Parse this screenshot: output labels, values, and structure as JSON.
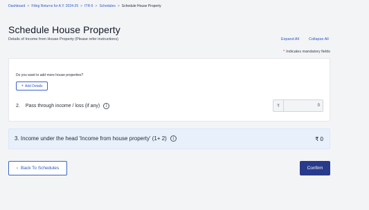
{
  "breadcrumb": {
    "items": [
      "Dashboard",
      "Filing Returns for A.Y. 2024-25",
      "ITR-5",
      "Schedules"
    ],
    "current": "Schedule House Property",
    "separator": ">"
  },
  "page": {
    "title": "Schedule House Property",
    "subtitle": "Details of Income from House Property (Please refer instructions)"
  },
  "controls": {
    "expand_all": "Expand All",
    "collapse_all": "Collapse All",
    "mandatory_star": "*",
    "mandatory_note": "Indicates mandatory fields"
  },
  "card": {
    "question": "Do you want to add more house properties?",
    "add_details_label": "Add Details",
    "pass_through_number": "2.",
    "pass_through_label": "Pass through income / loss (if any)",
    "currency_symbol": "₹",
    "pass_through_value": "0"
  },
  "income": {
    "label": "3. Income under the head 'Income from house property' (1+ 2)",
    "total": "₹ 0"
  },
  "footer": {
    "back_label": "Back To Schedules",
    "confirm_label": "Confirm"
  },
  "colors": {
    "link": "#2b58c4",
    "primary_button": "#283a8a",
    "income_bar_bg": "#e8f0fb",
    "mandatory_star": "#d32f2f"
  }
}
